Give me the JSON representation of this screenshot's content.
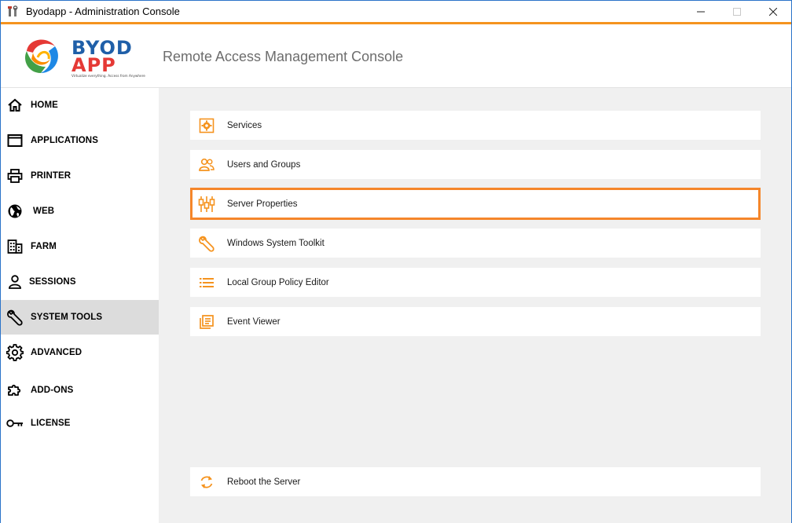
{
  "window": {
    "title": "Byodapp - Administration Console",
    "controls": {
      "minimize": "—",
      "maximize": "☐",
      "close": "✕"
    }
  },
  "header": {
    "logo": {
      "wordmark_line1": "BYOD",
      "wordmark_line2": "APP",
      "tagline": "Virtualize everything. Access from Anywhere"
    },
    "title": "Remote Access Management Console"
  },
  "sidebar": {
    "items": [
      {
        "label": "HOME",
        "icon": "home-icon",
        "active": false
      },
      {
        "label": "APPLICATIONS",
        "icon": "window-icon",
        "active": false
      },
      {
        "label": "PRINTER",
        "icon": "printer-icon",
        "active": false
      },
      {
        "label": "WEB",
        "icon": "globe-icon",
        "active": false
      },
      {
        "label": "FARM",
        "icon": "building-icon",
        "active": false
      },
      {
        "label": "SESSIONS",
        "icon": "user-icon",
        "active": false
      },
      {
        "label": "SYSTEM TOOLS",
        "icon": "wrench-icon",
        "active": true
      },
      {
        "label": "ADVANCED",
        "icon": "gear-icon",
        "active": false
      },
      {
        "label": "ADD-ONS",
        "icon": "puzzle-icon",
        "active": false
      },
      {
        "label": "LICENSE",
        "icon": "key-icon",
        "active": false
      }
    ]
  },
  "tools": {
    "items": [
      {
        "label": "Services",
        "icon": "services-gear-icon",
        "selected": false
      },
      {
        "label": "Users and Groups",
        "icon": "users-icon",
        "selected": false
      },
      {
        "label": "Server Properties",
        "icon": "sliders-icon",
        "selected": true
      },
      {
        "label": "Windows System Toolkit",
        "icon": "wrench-icon",
        "selected": false
      },
      {
        "label": "Local Group Policy Editor",
        "icon": "list-icon",
        "selected": false
      },
      {
        "label": "Event Viewer",
        "icon": "document-list-icon",
        "selected": false
      }
    ],
    "reboot": {
      "label": "Reboot the Server",
      "icon": "refresh-icon"
    }
  },
  "colors": {
    "accent": "#f5931e",
    "selection_border": "#f5862a",
    "active_nav_bg": "#dcdcdc",
    "content_bg": "#f0f0f0",
    "window_border": "#2b73c9"
  }
}
